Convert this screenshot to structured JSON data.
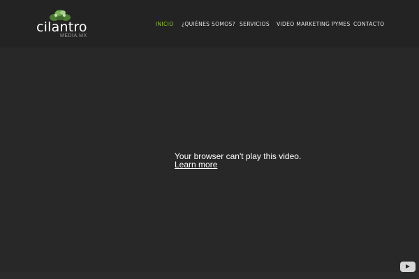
{
  "logo": {
    "wordmark": "cilantro",
    "subtitle": "MEDIA.MX"
  },
  "nav": {
    "items": [
      {
        "label": "INICIO",
        "active": true
      },
      {
        "label": "¿QUIÉNES SOMOS?",
        "active": false
      },
      {
        "label": "SERVICIOS",
        "active": false
      },
      {
        "label": "VIDEO MARKETING PYMES",
        "active": false
      },
      {
        "label": "CONTACTO",
        "active": false
      }
    ]
  },
  "video": {
    "message": "Your browser can't play this video.",
    "link_label": "Learn more"
  },
  "colors": {
    "accent": "#8cc63f",
    "header_bg": "#232323",
    "page_bg": "#282828"
  },
  "icons": {
    "logo_mark": "cilantro-leaves-icon",
    "player": "youtube-icon"
  }
}
